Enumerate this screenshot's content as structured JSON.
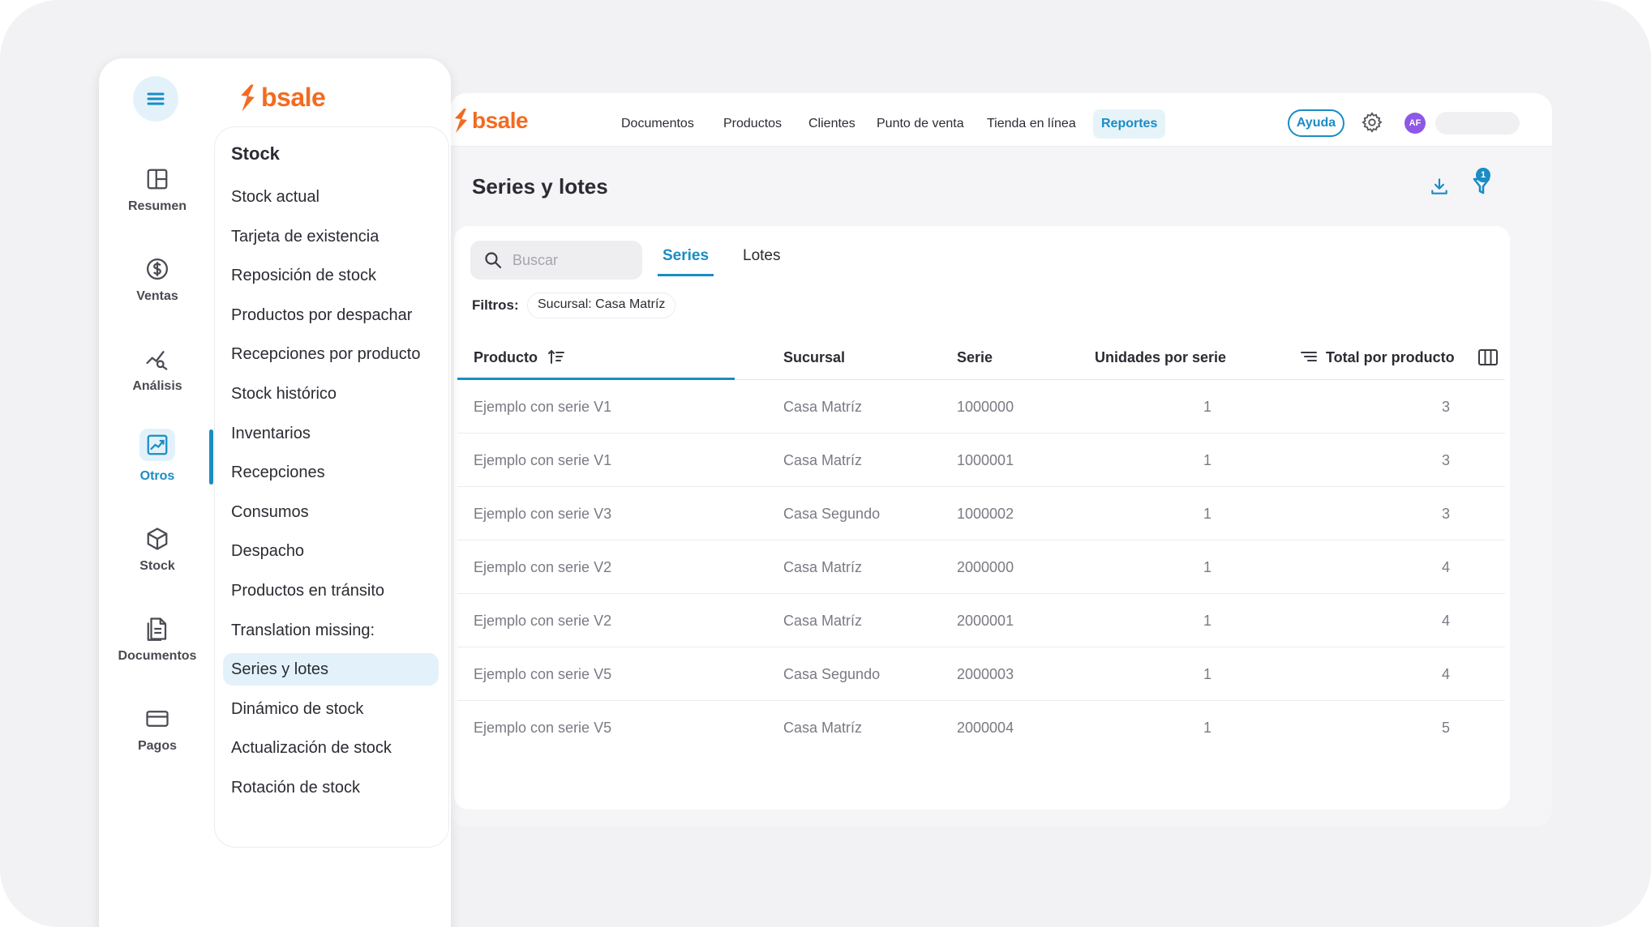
{
  "brand": {
    "name": "bsale",
    "color": "#f26b21"
  },
  "topnav": {
    "items": [
      {
        "label": "Documentos"
      },
      {
        "label": "Productos"
      },
      {
        "label": "Clientes"
      },
      {
        "label": "Punto de venta"
      },
      {
        "label": "Tienda en línea"
      },
      {
        "label": "Reportes",
        "active": true
      }
    ],
    "help_label": "Ayuda",
    "avatar_initials": "AF",
    "accent": "#1a8cc4"
  },
  "page": {
    "title": "Series y lotes",
    "filter_badge_count": "1"
  },
  "search": {
    "placeholder": "Buscar"
  },
  "tabs": [
    {
      "label": "Series",
      "active": true
    },
    {
      "label": "Lotes"
    }
  ],
  "filters": {
    "label": "Filtros:",
    "chips": [
      "Sucursal: Casa Matríz"
    ]
  },
  "table": {
    "columns": [
      "Producto",
      "Sucursal",
      "Serie",
      "Unidades por serie",
      "Total por producto"
    ],
    "rows": [
      {
        "producto": "Ejemplo con serie V1",
        "sucursal": "Casa Matríz",
        "serie": "1000000",
        "unidades": "1",
        "total": "3"
      },
      {
        "producto": "Ejemplo con serie V1",
        "sucursal": "Casa Matríz",
        "serie": "1000001",
        "unidades": "1",
        "total": "3"
      },
      {
        "producto": "Ejemplo con serie V3",
        "sucursal": "Casa Segundo",
        "serie": "1000002",
        "unidades": "1",
        "total": "3"
      },
      {
        "producto": "Ejemplo con serie V2",
        "sucursal": "Casa Matríz",
        "serie": "2000000",
        "unidades": "1",
        "total": "4"
      },
      {
        "producto": "Ejemplo con serie V2",
        "sucursal": "Casa Matríz",
        "serie": "2000001",
        "unidades": "1",
        "total": "4"
      },
      {
        "producto": "Ejemplo con serie V5",
        "sucursal": "Casa Segundo",
        "serie": "2000003",
        "unidades": "1",
        "total": "4"
      },
      {
        "producto": "Ejemplo con serie V5",
        "sucursal": "Casa Matríz",
        "serie": "2000004",
        "unidades": "1",
        "total": "5"
      }
    ]
  },
  "rail": {
    "items": [
      {
        "label": "Resumen",
        "icon": "layout-icon"
      },
      {
        "label": "Ventas",
        "icon": "dollar-icon"
      },
      {
        "label": "Análisis",
        "icon": "analytics-icon"
      },
      {
        "label": "Otros",
        "icon": "chart-image-icon",
        "active": true
      },
      {
        "label": "Stock",
        "icon": "box-icon"
      },
      {
        "label": "Documentos",
        "icon": "document-icon"
      },
      {
        "label": "Pagos",
        "icon": "card-icon"
      }
    ]
  },
  "submenu": {
    "title": "Stock",
    "items": [
      "Stock actual",
      "Tarjeta de existencia",
      "Reposición de stock",
      "Productos por despachar",
      "Recepciones por producto",
      "Stock histórico",
      "Inventarios",
      "Recepciones",
      "Consumos",
      "Despacho",
      "Productos en tránsito",
      "Translation missing:",
      "Series y lotes",
      "Dinámico de stock",
      "Actualización de stock",
      "Rotación de stock"
    ],
    "active_item": "Series y lotes"
  }
}
